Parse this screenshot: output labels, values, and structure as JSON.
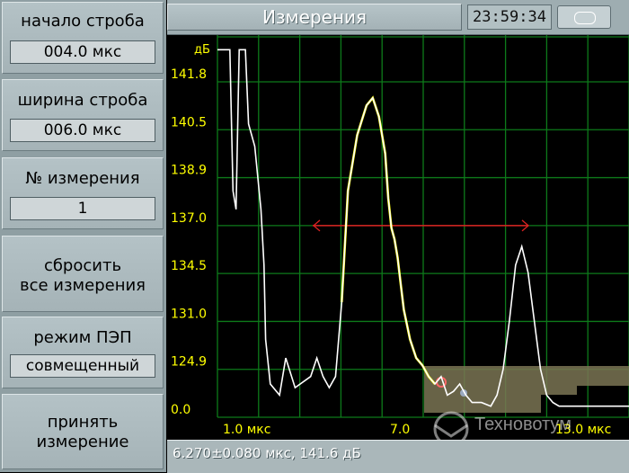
{
  "buttons": [
    {
      "label": "начало строба",
      "value": "004.0 мкс"
    },
    {
      "label": "ширина строба",
      "value": "006.0 мкс"
    },
    {
      "label": "№ измерения",
      "value": "1"
    },
    {
      "label": "сбросить\nвсе измерения"
    },
    {
      "label": "режим ПЭП",
      "value": "совмещенный"
    },
    {
      "label": "принять\nизмерение"
    }
  ],
  "header": {
    "title": "Измерения",
    "time": "23:59:34"
  },
  "status": {
    "text": "6.270±0.080 мкс, 141.6 дБ"
  },
  "watermark": {
    "text": "Техновотум"
  },
  "chart_data": {
    "type": "line",
    "ylabel": "дБ",
    "yticks": [
      "141.8",
      "140.5",
      "138.9",
      "137.0",
      "134.5",
      "131.0",
      "124.9",
      "0.0"
    ],
    "xticks": [
      "1.0 мкс",
      "7.0",
      "13.0 мкс"
    ],
    "threshold": "137.0",
    "colors": {
      "grid": "#0d7a1a",
      "trace": "#ffffff",
      "peak": "#ffff00",
      "threshold": "#dd2222",
      "labels": "#ffff00",
      "gate": "#7a7454"
    },
    "x_range": [
      1.0,
      14.25
    ],
    "series": [
      {
        "x": [
          1.0,
          1.1,
          1.2,
          1.4,
          1.5,
          1.6,
          1.7,
          1.8,
          1.9,
          2.0,
          2.2,
          2.4,
          2.5,
          2.55,
          2.7,
          3.0,
          3.2,
          3.5,
          4.0,
          4.2,
          4.4,
          4.6,
          4.8,
          5.0,
          5.2,
          5.5,
          5.8,
          6.0,
          6.2,
          6.4,
          6.5,
          6.6,
          6.7,
          6.8,
          6.9,
          7.0,
          7.2,
          7.4,
          7.6,
          7.8,
          8.0,
          8.2,
          8.4,
          8.6,
          8.8,
          9.0,
          9.2,
          9.5,
          9.8,
          10.0,
          10.2,
          10.4,
          10.6,
          10.8,
          11.0,
          11.2,
          11.4,
          11.6,
          11.8,
          12.0,
          12.2,
          12.4,
          12.6,
          12.8,
          13.0,
          13.2,
          13.5,
          14.0,
          14.25
        ],
        "y": [
          0.98,
          0.98,
          0.98,
          0.98,
          0.6,
          0.55,
          0.98,
          0.98,
          0.98,
          0.78,
          0.72,
          0.55,
          0.4,
          0.2,
          0.08,
          0.05,
          0.15,
          0.07,
          0.1,
          0.15,
          0.1,
          0.07,
          0.1,
          0.3,
          0.6,
          0.75,
          0.83,
          0.85,
          0.8,
          0.7,
          0.58,
          0.5,
          0.47,
          0.42,
          0.35,
          0.28,
          0.2,
          0.15,
          0.13,
          0.1,
          0.08,
          0.1,
          0.05,
          0.06,
          0.08,
          0.05,
          0.03,
          0.03,
          0.02,
          0.05,
          0.12,
          0.25,
          0.4,
          0.45,
          0.38,
          0.25,
          0.12,
          0.05,
          0.03,
          0.02,
          0.02,
          0.02,
          0.02,
          0.02,
          0.02,
          0.02,
          0.02,
          0.02,
          0.02
        ]
      }
    ]
  }
}
